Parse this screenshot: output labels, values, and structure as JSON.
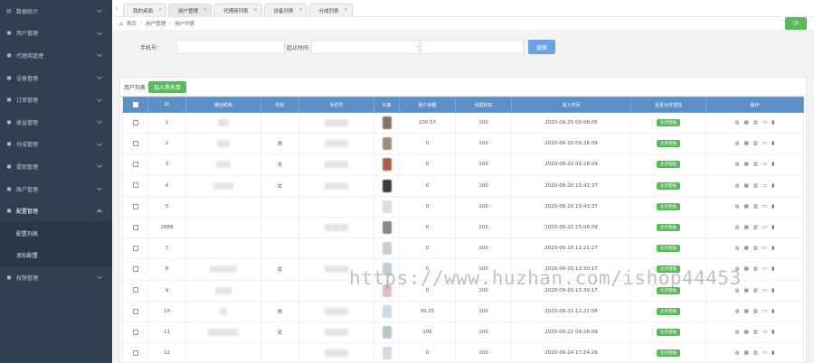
{
  "sidebar": {
    "items": [
      {
        "label": "数据统计",
        "icon": "chart-icon",
        "glyph": "▤"
      },
      {
        "label": "用户管理",
        "icon": "user-icon",
        "glyph": "●"
      },
      {
        "label": "代理商管理",
        "icon": "users-icon",
        "glyph": "●"
      },
      {
        "label": "设备管理",
        "icon": "device-icon",
        "glyph": "●"
      },
      {
        "label": "订单管理",
        "icon": "order-icon",
        "glyph": "●"
      },
      {
        "label": "收益管理",
        "icon": "income-icon",
        "glyph": "●"
      },
      {
        "label": "分成管理",
        "icon": "share-icon",
        "glyph": "●"
      },
      {
        "label": "提现管理",
        "icon": "withdraw-icon",
        "glyph": "●"
      },
      {
        "label": "账户管理",
        "icon": "account-icon",
        "glyph": "●"
      },
      {
        "label": "配置管理",
        "icon": "config-icon",
        "glyph": "●"
      }
    ],
    "sub_items": [
      "配置列表",
      "添加配置"
    ],
    "last_item": {
      "label": "权限管理",
      "icon": "permission-icon",
      "glyph": "●"
    }
  },
  "tabs": [
    {
      "label": "我的桌面",
      "active": false
    },
    {
      "label": "用户管理",
      "active": true
    },
    {
      "label": "代理商列表",
      "active": false
    },
    {
      "label": "设备列表",
      "active": false
    },
    {
      "label": "分成列表",
      "active": false
    }
  ],
  "breadcrumb": [
    "首页",
    "用户管理",
    "用户列表"
  ],
  "search": {
    "phone_label": "手机号：",
    "time_label": "起止时间",
    "dash": "-",
    "button": "搜索"
  },
  "panel": {
    "title": "用户列表",
    "add_button": "加入黑名单"
  },
  "table": {
    "headers": [
      "",
      "ID",
      "微信昵称",
      "性别",
      "手机号",
      "头像",
      "账户余额",
      "当前折扣",
      "加入时间",
      "是否允许登陆",
      "操作"
    ],
    "rows": [
      {
        "id": "1",
        "gender": "",
        "balance": "100.57",
        "discount": "100",
        "time": "2020-06-20 09:08:05",
        "status": "允许登陆",
        "avatar": "#8a7266",
        "nick_w": 12,
        "phone_w": 26
      },
      {
        "id": "2",
        "gender": "男",
        "balance": "0",
        "discount": "100",
        "time": "2020-06-20 09:28:09",
        "status": "允许登陆",
        "avatar": "#9c8f7e",
        "nick_w": 14,
        "phone_w": 26
      },
      {
        "id": "3",
        "gender": "女",
        "balance": "0",
        "discount": "100",
        "time": "2020-06-20 09:28:09",
        "status": "允许登陆",
        "avatar": "#a8604c",
        "nick_w": 16,
        "phone_w": 26
      },
      {
        "id": "4",
        "gender": "女",
        "balance": "0",
        "discount": "100",
        "time": "2020-06-20 10:43:37",
        "status": "允许登陆",
        "avatar": "#384038",
        "nick_w": 22,
        "phone_w": 26
      },
      {
        "id": "5",
        "gender": "",
        "balance": "0",
        "discount": "100",
        "time": "2020-06-20 10:43:37",
        "status": "允许登陆",
        "avatar": "#d8dde2",
        "nick_w": 0,
        "phone_w": 0
      },
      {
        "id": "2888",
        "gender": "",
        "balance": "0",
        "discount": "100",
        "time": "2020-06-21 15:06:09",
        "status": "允许登陆",
        "avatar": "#8e8884",
        "nick_w": 0,
        "phone_w": 26
      },
      {
        "id": "7",
        "gender": "",
        "balance": "0",
        "discount": "100",
        "time": "2020-06-20 11:21:27",
        "status": "允许登陆",
        "avatar": "#c9cdd2",
        "nick_w": 0,
        "phone_w": 0
      },
      {
        "id": "8",
        "gender": "女",
        "balance": "0",
        "discount": "100",
        "time": "2020-06-20 13:30:17",
        "status": "允许登陆",
        "avatar": "#c6ccd4",
        "nick_w": 30,
        "phone_w": 26
      },
      {
        "id": "9",
        "gender": "",
        "balance": "0",
        "discount": "100",
        "time": "2020-06-20 13:30:17",
        "status": "允许登陆",
        "avatar": "#e4b8c4",
        "nick_w": 18,
        "phone_w": 0
      },
      {
        "id": "10",
        "gender": "男",
        "balance": "99.25",
        "discount": "100",
        "time": "2020-06-21 12:22:08",
        "status": "允许登陆",
        "avatar": "#cfd8e0",
        "nick_w": 8,
        "phone_w": 26
      },
      {
        "id": "11",
        "gender": "女",
        "balance": "106",
        "discount": "100",
        "time": "2020-06-22 09:28:09",
        "status": "允许登陆",
        "avatar": "#b8c4cc",
        "nick_w": 34,
        "phone_w": 26
      },
      {
        "id": "12",
        "gender": "",
        "balance": "0",
        "discount": "100",
        "time": "2020-06-24 17:24:26",
        "status": "允许登陆",
        "avatar": "#d4dadf",
        "nick_w": 0,
        "phone_w": 26
      }
    ],
    "ops": [
      {
        "glyph": "◍",
        "icon": "view-icon"
      },
      {
        "glyph": "▦",
        "icon": "edit-icon"
      },
      {
        "glyph": "▥",
        "icon": "list-icon"
      },
      {
        "glyph": "▭",
        "icon": "disable-icon"
      },
      {
        "glyph": "▮",
        "icon": "delete-icon"
      }
    ]
  },
  "refresh": {
    "glyph": "⟳"
  },
  "watermark": "https://www.huzhan.com/ishop44453"
}
